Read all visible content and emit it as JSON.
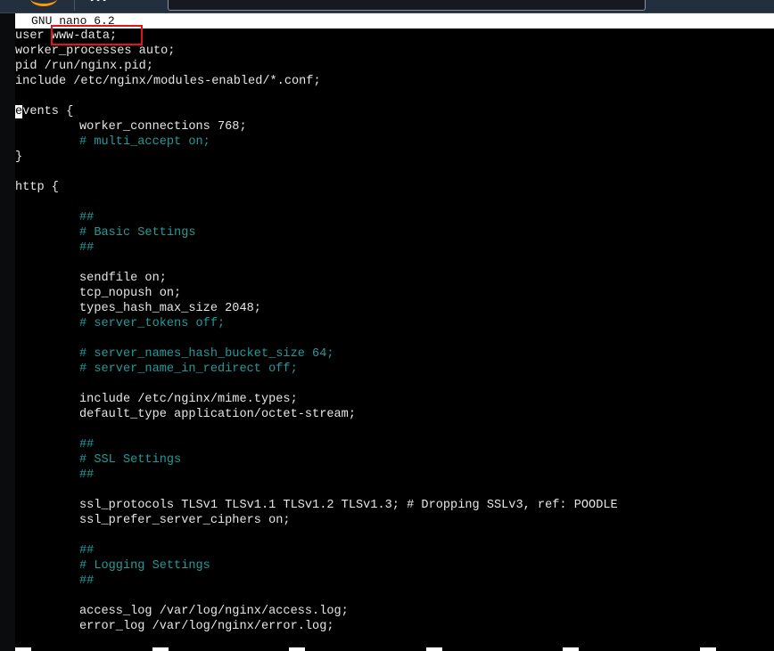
{
  "window": {
    "app": "GNU nano",
    "title_bar": "GNU nano 6.2",
    "host_console": "AWS console header"
  },
  "icons": {
    "aws_logo": "aws-smile-logo",
    "services_menu": "grid-icon",
    "search": "search-box"
  },
  "editor": {
    "cursor": {
      "line": 6,
      "column": 1,
      "char": "e"
    },
    "highlight": {
      "line": 1,
      "text": "www-data;",
      "color": "#e3141b"
    },
    "colors": {
      "text": "#e6e6e6",
      "comment": "#239a9a",
      "background": "#000000"
    },
    "lines": [
      {
        "indent": "",
        "text": "user www-data;",
        "type": "code"
      },
      {
        "indent": "",
        "text": "worker_processes auto;",
        "type": "code"
      },
      {
        "indent": "",
        "text": "pid /run/nginx.pid;",
        "type": "code"
      },
      {
        "indent": "",
        "text": "include /etc/nginx/modules-enabled/*.conf;",
        "type": "code"
      },
      {
        "indent": "",
        "text": "",
        "type": "blank"
      },
      {
        "indent": "",
        "text": "events {",
        "type": "code"
      },
      {
        "indent": "\t",
        "text": "worker_connections 768;",
        "type": "code"
      },
      {
        "indent": "\t",
        "text": "# multi_accept on;",
        "type": "comment"
      },
      {
        "indent": "",
        "text": "}",
        "type": "code"
      },
      {
        "indent": "",
        "text": "",
        "type": "blank"
      },
      {
        "indent": "",
        "text": "http {",
        "type": "code"
      },
      {
        "indent": "",
        "text": "",
        "type": "blank"
      },
      {
        "indent": "\t",
        "text": "##",
        "type": "comment"
      },
      {
        "indent": "\t",
        "text": "# Basic Settings",
        "type": "comment"
      },
      {
        "indent": "\t",
        "text": "##",
        "type": "comment"
      },
      {
        "indent": "",
        "text": "",
        "type": "blank"
      },
      {
        "indent": "\t",
        "text": "sendfile on;",
        "type": "code"
      },
      {
        "indent": "\t",
        "text": "tcp_nopush on;",
        "type": "code"
      },
      {
        "indent": "\t",
        "text": "types_hash_max_size 2048;",
        "type": "code"
      },
      {
        "indent": "\t",
        "text": "# server_tokens off;",
        "type": "comment"
      },
      {
        "indent": "",
        "text": "",
        "type": "blank"
      },
      {
        "indent": "\t",
        "text": "# server_names_hash_bucket_size 64;",
        "type": "comment"
      },
      {
        "indent": "\t",
        "text": "# server_name_in_redirect off;",
        "type": "comment"
      },
      {
        "indent": "",
        "text": "",
        "type": "blank"
      },
      {
        "indent": "\t",
        "text": "include /etc/nginx/mime.types;",
        "type": "code"
      },
      {
        "indent": "\t",
        "text": "default_type application/octet-stream;",
        "type": "code"
      },
      {
        "indent": "",
        "text": "",
        "type": "blank"
      },
      {
        "indent": "\t",
        "text": "##",
        "type": "comment"
      },
      {
        "indent": "\t",
        "text": "# SSL Settings",
        "type": "comment"
      },
      {
        "indent": "\t",
        "text": "##",
        "type": "comment"
      },
      {
        "indent": "",
        "text": "",
        "type": "blank"
      },
      {
        "indent": "\t",
        "text": "ssl_protocols TLSv1 TLSv1.1 TLSv1.2 TLSv1.3; # Dropping SSLv3, ref: POODLE",
        "type": "code"
      },
      {
        "indent": "\t",
        "text": "ssl_prefer_server_ciphers on;",
        "type": "code"
      },
      {
        "indent": "",
        "text": "",
        "type": "blank"
      },
      {
        "indent": "\t",
        "text": "##",
        "type": "comment"
      },
      {
        "indent": "\t",
        "text": "# Logging Settings",
        "type": "comment"
      },
      {
        "indent": "\t",
        "text": "##",
        "type": "comment"
      },
      {
        "indent": "",
        "text": "",
        "type": "blank"
      },
      {
        "indent": "\t",
        "text": "access_log /var/log/nginx/access.log;",
        "type": "code"
      },
      {
        "indent": "\t",
        "text": "error_log /var/log/nginx/error.log;",
        "type": "code"
      }
    ]
  },
  "shortcut_bar": {
    "visible_key_markers": 6
  }
}
